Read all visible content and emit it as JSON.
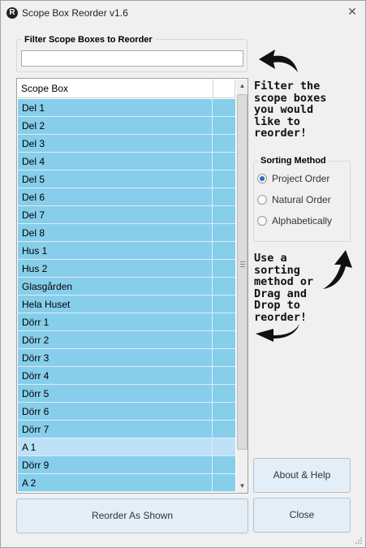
{
  "window": {
    "title": "Scope Box Reorder v1.6",
    "icon": "app-icon",
    "close_glyph": "✕"
  },
  "filter": {
    "label": "Filter Scope Boxes to Reorder",
    "value": "",
    "placeholder": ""
  },
  "grid": {
    "column_header": "Scope Box",
    "rows": [
      "Del 1",
      "Del 2",
      "Del 3",
      "Del 4",
      "Del 5",
      "Del 6",
      "Del 7",
      "Del 8",
      "Hus 1",
      "Hus 2",
      "Glasgården",
      "Hela Huset",
      "Dörr 1",
      "Dörr 2",
      "Dörr 3",
      "Dörr 4",
      "Dörr 5",
      "Dörr 6",
      "Dörr 7",
      "A 1",
      "Dörr 9",
      "A 2"
    ],
    "selected_row": "A 1",
    "row_color": "#87ceeb",
    "selected_color": "#bfe1f8"
  },
  "scrollbar": {
    "up_glyph": "▲",
    "down_glyph": "▼"
  },
  "hints": {
    "filter_hint": "Filter the\nscope boxes\nyou would\nlike to\nreorder!",
    "sort_hint": "Use a\nsorting\nmethod or\nDrag and\nDrop to\nreorder!"
  },
  "sorting": {
    "label": "Sorting Method",
    "options": [
      "Project Order",
      "Natural Order",
      "Alphabetically"
    ],
    "selected": "Project Order"
  },
  "buttons": {
    "about": "About & Help",
    "reorder": "Reorder As Shown",
    "close": "Close"
  }
}
